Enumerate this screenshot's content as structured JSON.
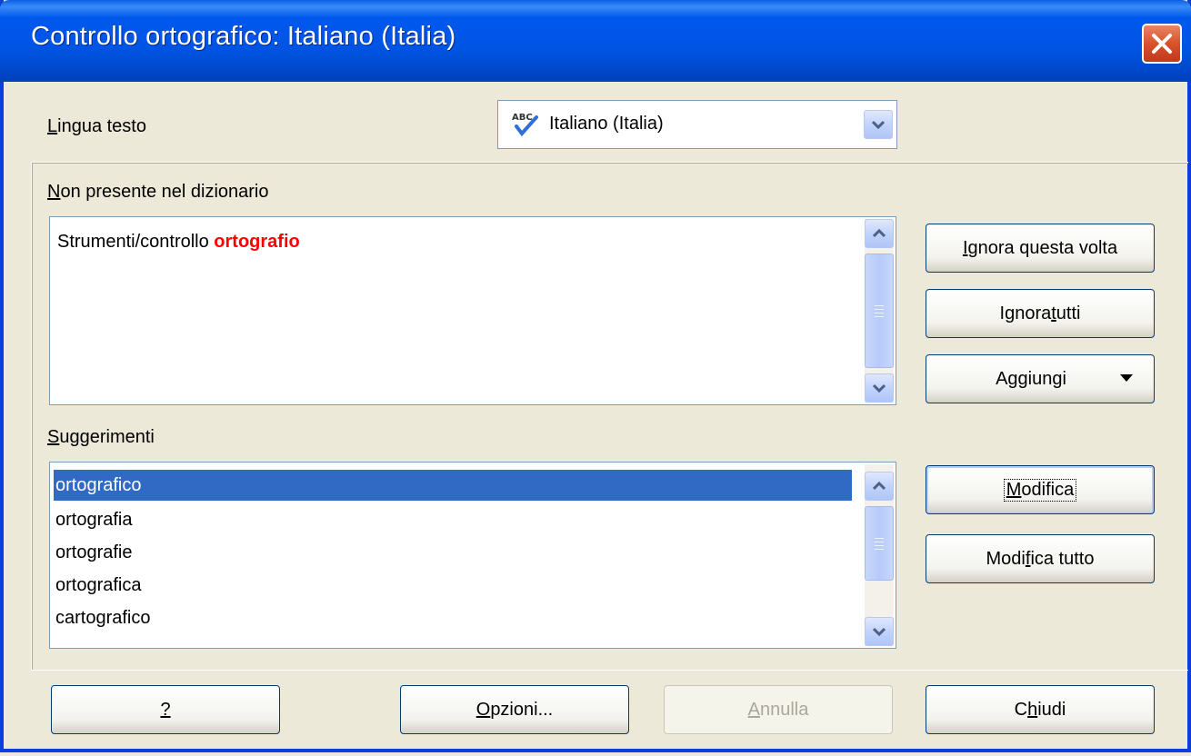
{
  "window": {
    "title": "Controllo ortografico: Italiano (Italia)"
  },
  "language": {
    "label": "Lingua testo",
    "accel": "L",
    "rest": "ingua testo",
    "value": "Italiano (Italia)"
  },
  "not_in_dict": {
    "label_accel": "N",
    "label_rest": "on presente nel dizionario",
    "text_plain": "Strumenti/controllo ",
    "text_error": "ortografio",
    "error_color": "#ff0000"
  },
  "suggestions": {
    "label_accel": "S",
    "label_rest": "uggerimenti",
    "items": [
      "ortografico",
      "ortografia",
      "ortografie",
      "ortografica",
      "cartografico"
    ],
    "selected_index": 0
  },
  "buttons": {
    "ignore_once": {
      "accel": "I",
      "rest": "gnora questa volta"
    },
    "ignore_all": {
      "pre": "Ignora ",
      "accel": "t",
      "rest": "utti"
    },
    "add": {
      "label": "Aggiungi"
    },
    "change": {
      "pre": "",
      "accel": "M",
      "rest": "odifica"
    },
    "change_all": {
      "pre": "Modi",
      "accel": "f",
      "rest": "ica tutto"
    },
    "help": {
      "accel": "?"
    },
    "options": {
      "accel": "O",
      "rest": "pzioni..."
    },
    "undo": {
      "accel": "A",
      "rest": "nnulla"
    },
    "close": {
      "pre": "C",
      "accel": "h",
      "rest": "iudi"
    }
  },
  "colors": {
    "title_bar": "#0054e3",
    "selection": "#316ac5",
    "dialog_bg": "#ece9d8"
  },
  "icons": [
    "spellcheck-icon",
    "close-icon",
    "chevron-down-icon",
    "chevron-up-icon",
    "dropdown-arrow-icon"
  ]
}
